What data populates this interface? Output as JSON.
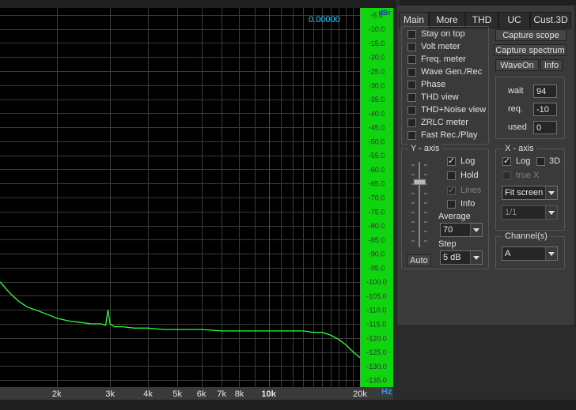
{
  "readout": "0.00000",
  "y_unit": "dBr",
  "x_unit": "Hz",
  "y_ticks": [
    "-5.0",
    "-10.0",
    "-15.0",
    "-20.0",
    "-25.0",
    "-30.0",
    "-35.0",
    "-40.0",
    "-45.0",
    "-50.0",
    "-55.0",
    "-60.0",
    "-65.0",
    "-70.0",
    "-75.0",
    "-80.0",
    "-85.0",
    "-90.0",
    "-95.0",
    "-100.0",
    "-105.0",
    "-110.0",
    "-115.0",
    "-120.0",
    "-125.0",
    "-130.0",
    "-135.0"
  ],
  "x_ticks": [
    {
      "label": "2k",
      "hz": 2000
    },
    {
      "label": "3k",
      "hz": 3000
    },
    {
      "label": "4k",
      "hz": 4000
    },
    {
      "label": "5k",
      "hz": 5000
    },
    {
      "label": "6k",
      "hz": 6000
    },
    {
      "label": "7k",
      "hz": 7000
    },
    {
      "label": "8k",
      "hz": 8000
    },
    {
      "label": "10k",
      "hz": 10000
    },
    {
      "label": "20k",
      "hz": 20000
    }
  ],
  "colors": {
    "trace": "#2aff3a",
    "grid": "#3a3a3a",
    "ybar": "#11d411",
    "readout": "#20d0ff"
  },
  "chart_data": {
    "type": "line",
    "xlabel": "Hz",
    "ylabel": "dBr",
    "xscale": "log",
    "xlim": [
      1300,
      20000
    ],
    "ylim": [
      -137.5,
      -2.5
    ],
    "grid": true,
    "series": [
      {
        "x": [
          1300,
          1400,
          1500,
          1600,
          1700,
          1800,
          1900,
          2000,
          2200,
          2400,
          2600,
          2800,
          2900,
          2950,
          3000,
          3100,
          3300,
          3600,
          4000,
          4500,
          5000,
          6000,
          7000,
          8000,
          9000,
          10000,
          11000,
          12000,
          13000,
          14000,
          15000,
          16000,
          17000,
          18000,
          19000,
          20000
        ],
        "y": [
          -100,
          -104,
          -107,
          -109,
          -110,
          -111,
          -112,
          -113,
          -114,
          -114.5,
          -115,
          -115,
          -115.5,
          -110,
          -115,
          -116,
          -116,
          -116.5,
          -116.5,
          -117,
          -117,
          -117,
          -117.5,
          -117.5,
          -117.5,
          -117.5,
          -117.5,
          -117.5,
          -117.5,
          -118,
          -118,
          -119,
          -120.5,
          -122.5,
          -125,
          -127
        ]
      }
    ]
  },
  "tabs": [
    "Main",
    "More",
    "THD",
    "UC",
    "Cust.3D"
  ],
  "active_tab": "Main",
  "options": [
    "Stay on top",
    "Volt meter",
    "Freq. meter",
    "Wave Gen./Rec",
    "Phase",
    "THD view",
    "THD+Noise view",
    "ZRLC meter",
    "Fast Rec./Play"
  ],
  "buttons": {
    "capture_scope": "Capture scope",
    "capture_spectrum": "Capture spectrum",
    "waveon": "WaveOn",
    "info": "Info",
    "auto": "Auto"
  },
  "timing": {
    "wait_label": "wait",
    "wait_value": "94",
    "req_label": "req.",
    "req_value": "-10",
    "used_label": "used",
    "used_value": "0"
  },
  "y_axis": {
    "title": "Y - axis",
    "log_label": "Log",
    "log_checked": true,
    "hold_label": "Hold",
    "hold_checked": false,
    "lines_label": "Lines",
    "lines_checked": true,
    "info_label": "Info",
    "info_checked": false,
    "average_label": "Average",
    "average_value": "70",
    "step_label": "Step",
    "step_value": "5 dB"
  },
  "x_axis": {
    "title": "X - axis",
    "log_label": "Log",
    "log_checked": true,
    "3d_label": "3D",
    "3d_checked": false,
    "truex_label": "true X",
    "truex_checked": false,
    "fit_value": "Fit screen",
    "ratio_value": "1/1"
  },
  "channels": {
    "title": "Channel(s)",
    "value": "A"
  }
}
